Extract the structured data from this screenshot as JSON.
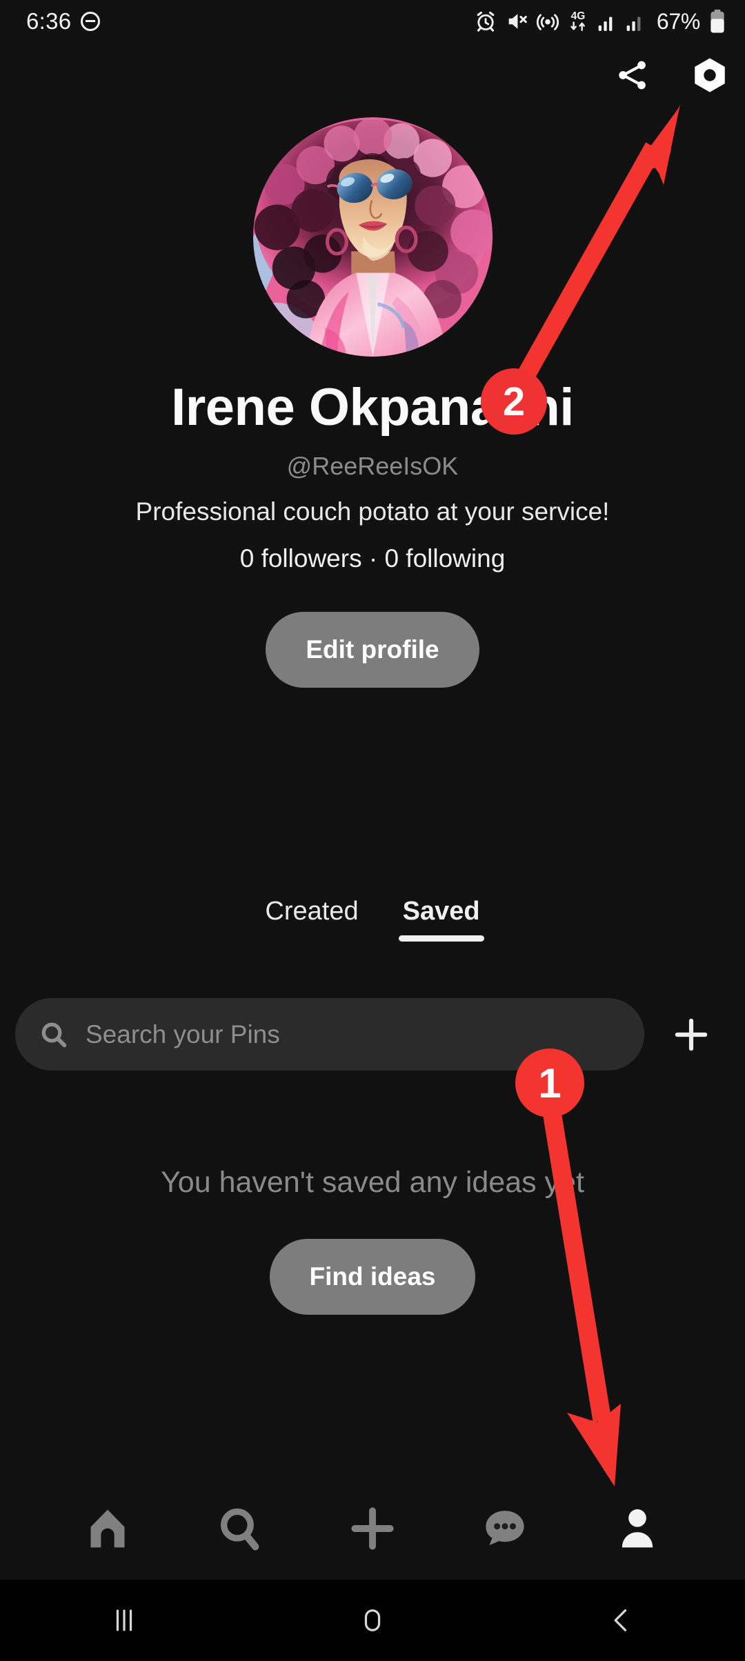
{
  "status_bar": {
    "time": "6:36",
    "battery_percent": "67%",
    "network_type": "4G",
    "icons": [
      "do-not-disturb-icon",
      "alarm-icon",
      "mute-icon",
      "hotspot-icon",
      "data-transfer-icon",
      "signal-sim1-icon",
      "signal-sim2-icon",
      "battery-icon"
    ]
  },
  "top_actions": {
    "share_label": "share-icon",
    "settings_label": "settings-gear-icon"
  },
  "profile": {
    "display_name": "Irene Okpanachi",
    "username": "@ReeReeIsOK",
    "bio": "Professional couch potato at your service!",
    "stats": "0 followers · 0 following",
    "edit_profile_label": "Edit profile",
    "avatar_alt": "illustrated-woman-pink-curly-hair-sunglasses"
  },
  "tabs": [
    {
      "label": "Created",
      "active": false
    },
    {
      "label": "Saved",
      "active": true
    }
  ],
  "search": {
    "placeholder": "Search your Pins",
    "value": "",
    "icon": "search-icon",
    "add_label": "plus-icon"
  },
  "empty_state": {
    "message": "You haven't saved any ideas yet",
    "action_label": "Find ideas"
  },
  "bottom_nav": [
    {
      "name": "home",
      "icon": "home-icon",
      "active": false
    },
    {
      "name": "search",
      "icon": "search-icon",
      "active": false
    },
    {
      "name": "create",
      "icon": "plus-icon",
      "active": false
    },
    {
      "name": "updates",
      "icon": "chat-bubble-icon",
      "active": false
    },
    {
      "name": "profile",
      "icon": "person-icon",
      "active": true
    }
  ],
  "system_nav": [
    {
      "name": "recents",
      "icon": "recents-icon"
    },
    {
      "name": "home",
      "icon": "home-square-icon"
    },
    {
      "name": "back",
      "icon": "back-chevron-icon"
    }
  ],
  "annotations": {
    "markers": [
      {
        "number": "1",
        "target": "profile-tab-bottom-nav"
      },
      {
        "number": "2",
        "target": "settings-gear-icon"
      }
    ],
    "color": "#f4352f"
  },
  "colors": {
    "background": "#111111",
    "surface": "#2b2b2b",
    "button": "#7d7d7d",
    "text_primary": "#fafafa",
    "text_muted": "#8a8a8a",
    "accent_annotation": "#f4352f"
  }
}
